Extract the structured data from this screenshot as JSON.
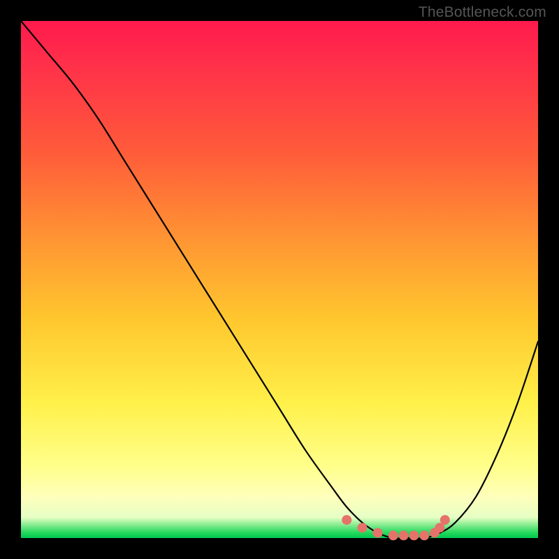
{
  "watermark": "TheBottleneck.com",
  "chart_data": {
    "type": "line",
    "title": "",
    "xlabel": "",
    "ylabel": "",
    "xlim": [
      0,
      100
    ],
    "ylim": [
      0,
      100
    ],
    "series": [
      {
        "name": "bottleneck-curve",
        "x": [
          0,
          5,
          10,
          15,
          20,
          25,
          30,
          35,
          40,
          45,
          50,
          55,
          60,
          63,
          66,
          69,
          72,
          75,
          78,
          81,
          84,
          88,
          92,
          96,
          100
        ],
        "values": [
          100,
          94,
          88,
          81,
          73,
          65,
          57,
          49,
          41,
          33,
          25,
          17,
          10,
          6,
          3,
          1,
          0,
          0,
          0,
          1,
          3,
          8,
          16,
          26,
          38
        ]
      }
    ],
    "markers": {
      "name": "highlight-dots",
      "x": [
        63,
        66,
        69,
        72,
        74,
        76,
        78,
        80,
        81,
        82
      ],
      "values": [
        3.5,
        2.0,
        1.0,
        0.5,
        0.5,
        0.5,
        0.5,
        1.0,
        2.0,
        3.5
      ],
      "color": "#e5736a"
    },
    "gradient_stops": [
      {
        "pos": 0,
        "color": "#ff1a4d"
      },
      {
        "pos": 25,
        "color": "#ff5a3a"
      },
      {
        "pos": 58,
        "color": "#ffc82e"
      },
      {
        "pos": 86,
        "color": "#ffff8a"
      },
      {
        "pos": 99,
        "color": "#22d85a"
      }
    ]
  }
}
